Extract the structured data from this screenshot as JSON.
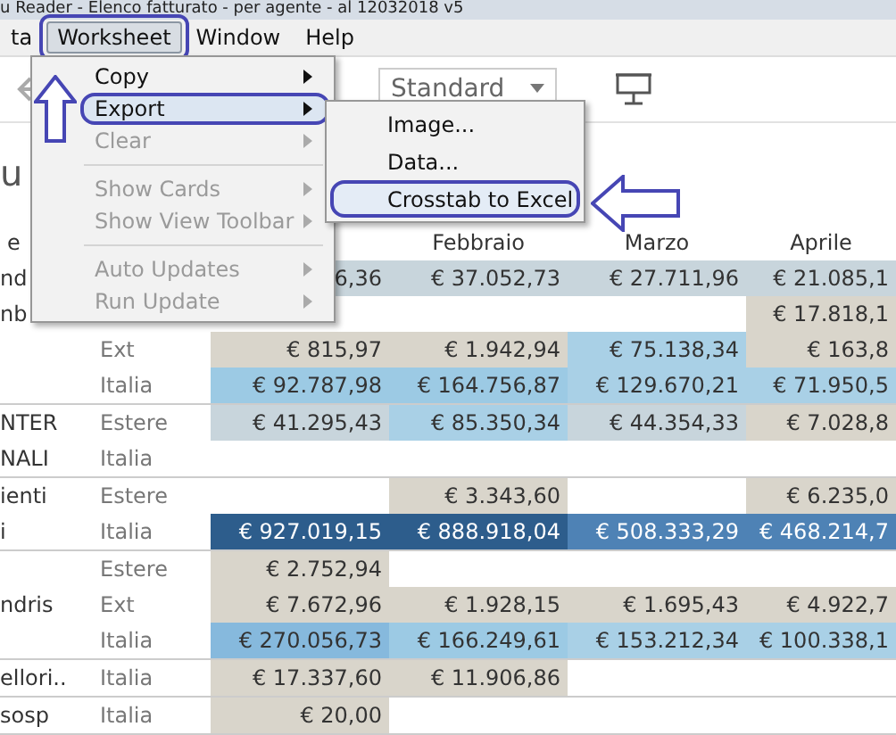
{
  "window": {
    "title": "u Reader - Elenco fatturato - per agente - al 12032018 v5"
  },
  "menu_bar": [
    {
      "label": "ta",
      "selected": false,
      "circled": false
    },
    {
      "label": "Worksheet",
      "selected": true,
      "circled": true
    },
    {
      "label": "Window",
      "selected": false,
      "circled": false
    },
    {
      "label": "Help",
      "selected": false,
      "circled": false
    }
  ],
  "toolbar": {
    "dropdown": {
      "value": "Standard"
    }
  },
  "heading": "u",
  "table": {
    "columns": [
      "e",
      "Febbraio",
      "Marzo",
      "Aprile"
    ],
    "groups": [
      {
        "rows": [
          {
            "agent": "nd",
            "cells": [
              {
                "text": "6,36",
                "color": "#c8d5dc"
              },
              {
                "text": "€ 37.052,73",
                "color": "#c8d5dc"
              },
              {
                "text": "€ 27.711,96",
                "color": "#c8d5dc"
              },
              {
                "text": "€ 21.085,1",
                "color": "#c8d5dc"
              }
            ]
          },
          {
            "agent": "nb",
            "cells": [
              null,
              null,
              null,
              {
                "text": "€ 17.818,1",
                "color": "#d9d5cb"
              }
            ]
          },
          {
            "segment": "Ext",
            "cells": [
              {
                "text": "€ 815,97",
                "color": "#d9d5cb"
              },
              {
                "text": "€ 1.942,94",
                "color": "#d9d5cb"
              },
              {
                "text": "€ 75.138,34",
                "color": "#a9d0e6"
              },
              {
                "text": "€ 163,8",
                "color": "#d9d5cb"
              }
            ]
          },
          {
            "segment": "Italia",
            "cells": [
              {
                "text": "€ 92.787,98",
                "color": "#9ccae4"
              },
              {
                "text": "€ 164.756,87",
                "color": "#9ccae4"
              },
              {
                "text": "€ 129.670,21",
                "color": "#a9d0e6"
              },
              {
                "text": "€ 71.950,5",
                "color": "#a9d0e6"
              }
            ]
          }
        ]
      },
      {
        "rows": [
          {
            "agent": "NTER",
            "segment": "Estere",
            "cells": [
              {
                "text": "€ 41.295,43",
                "color": "#c8d5dc"
              },
              {
                "text": "€ 85.350,34",
                "color": "#a9d0e6"
              },
              {
                "text": "€ 44.354,33",
                "color": "#c8d5dc"
              },
              {
                "text": "€ 7.028,8",
                "color": "#d9d5cb"
              }
            ]
          },
          {
            "agent": "NALI",
            "segment": "Italia",
            "cells": [
              null,
              null,
              null,
              null
            ]
          }
        ]
      },
      {
        "rows": [
          {
            "agent": "ienti",
            "segment": "Estere",
            "cells": [
              null,
              {
                "text": "€ 3.343,60",
                "color": "#d9d5cb"
              },
              null,
              {
                "text": "€ 6.235,0",
                "color": "#d9d5cb"
              }
            ]
          },
          {
            "agent": "i",
            "segment": "Italia",
            "cells": [
              {
                "text": "€ 927.019,15",
                "color": "#2d5d8c"
              },
              {
                "text": "€ 888.918,04",
                "color": "#2d5d8c"
              },
              {
                "text": "€ 508.333,29",
                "color": "#4e82b5"
              },
              {
                "text": "€ 468.214,7",
                "color": "#4e82b5"
              }
            ]
          }
        ]
      },
      {
        "rows": [
          {
            "segment": "Estere",
            "cells": [
              {
                "text": "€ 2.752,94",
                "color": "#d9d5cb"
              },
              null,
              null,
              null
            ]
          },
          {
            "agent": "ndris",
            "segment": "Ext",
            "cells": [
              {
                "text": "€ 7.672,96",
                "color": "#d9d5cb"
              },
              {
                "text": "€ 1.928,15",
                "color": "#d9d5cb"
              },
              {
                "text": "€ 1.695,43",
                "color": "#d9d5cb"
              },
              {
                "text": "€ 4.922,7",
                "color": "#d9d5cb"
              }
            ]
          },
          {
            "segment": "Italia",
            "cells": [
              {
                "text": "€ 270.056,73",
                "color": "#86b9dd"
              },
              {
                "text": "€ 166.249,61",
                "color": "#9ccae4"
              },
              {
                "text": "€ 153.212,34",
                "color": "#a9d0e6"
              },
              {
                "text": "€ 100.338,1",
                "color": "#a9d0e6"
              }
            ]
          }
        ]
      },
      {
        "rows": [
          {
            "agent": "ellori..",
            "segment": "Italia",
            "cells": [
              {
                "text": "€ 17.337,60",
                "color": "#d9d5cb"
              },
              {
                "text": "€ 11.906,86",
                "color": "#d9d5cb"
              },
              null,
              null
            ]
          }
        ]
      },
      {
        "rows": [
          {
            "agent": "sosp",
            "segment": "Italia",
            "cells": [
              {
                "text": "€ 20,00",
                "color": "#d9d5cb"
              },
              null,
              null,
              null
            ]
          }
        ]
      }
    ]
  },
  "menu": {
    "items": [
      {
        "kind": "item",
        "label": "Copy",
        "submenu": true,
        "disabled": false,
        "selected": false,
        "circled": false
      },
      {
        "kind": "item",
        "label": "Export",
        "submenu": true,
        "disabled": false,
        "selected": true,
        "circled": true
      },
      {
        "kind": "item",
        "label": "Clear",
        "submenu": true,
        "disabled": true,
        "selected": false,
        "circled": false
      },
      {
        "kind": "separator"
      },
      {
        "kind": "item",
        "label": "Show Cards",
        "submenu": true,
        "disabled": true,
        "selected": false,
        "circled": false
      },
      {
        "kind": "item",
        "label": "Show View Toolbar",
        "submenu": true,
        "disabled": true,
        "selected": false,
        "circled": false
      },
      {
        "kind": "separator"
      },
      {
        "kind": "item",
        "label": "Auto Updates",
        "submenu": true,
        "disabled": true,
        "selected": false,
        "circled": false
      },
      {
        "kind": "item",
        "label": "Run Update",
        "submenu": true,
        "disabled": true,
        "selected": false,
        "circled": false
      }
    ]
  },
  "submenu": {
    "items": [
      {
        "label": "Image...",
        "selected": false,
        "circled": false
      },
      {
        "label": "Data...",
        "selected": false,
        "circled": false
      },
      {
        "label": "Crosstab to Excel",
        "selected": true,
        "circled": true
      }
    ]
  }
}
